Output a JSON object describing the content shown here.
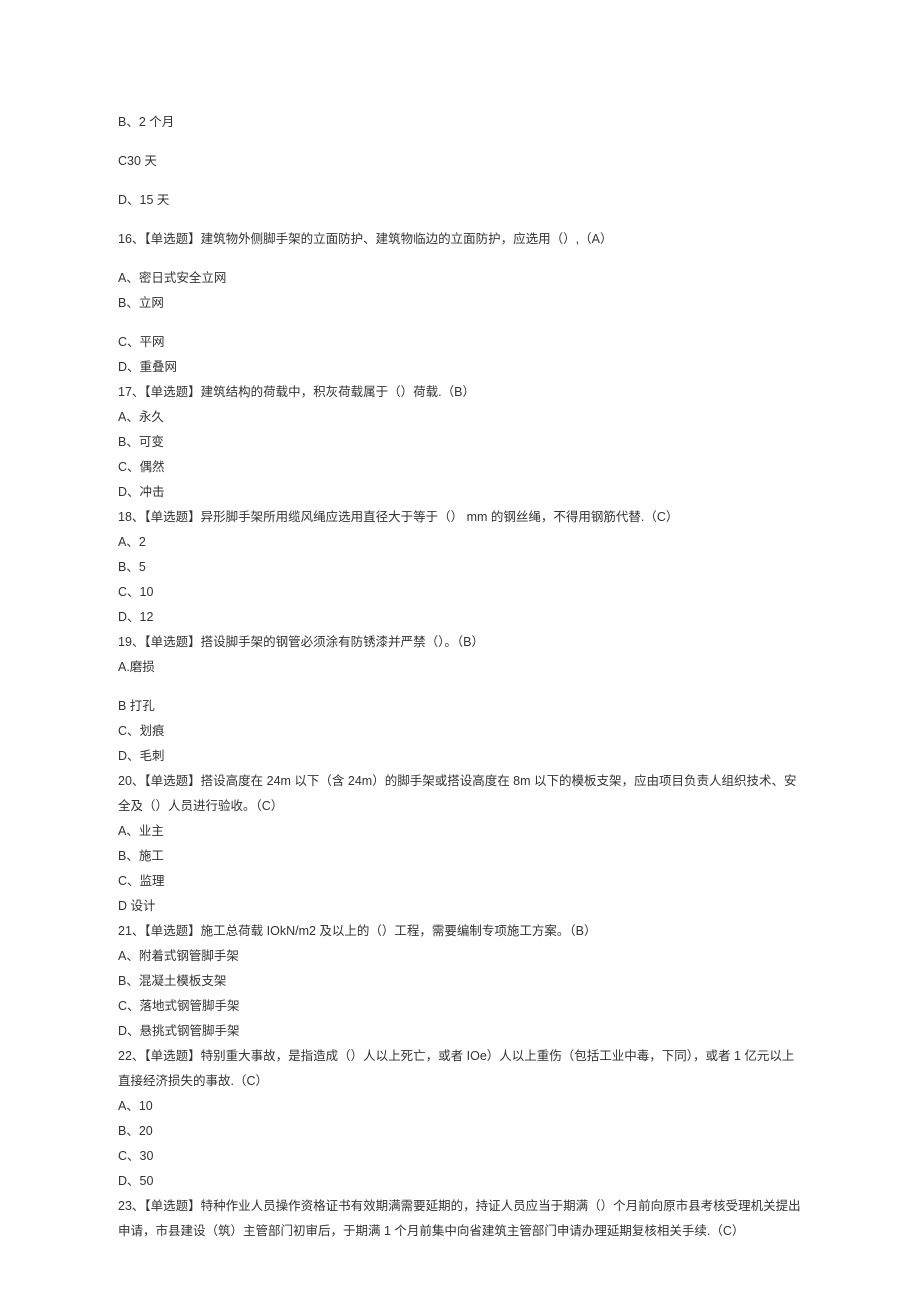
{
  "q15": {
    "b": "B、2 个月",
    "c": "C30 天",
    "d": "D、15 天"
  },
  "q16": {
    "stem": "16、【单选题】建筑物外侧脚手架的立面防护、建筑物临边的立面防护，应选用（）,（A）",
    "a": "A、密日式安全立网",
    "b": "B、立网",
    "c": "C、平网",
    "d": "D、重叠网"
  },
  "q17": {
    "stem": "17、【单选题】建筑结构的荷载中，积灰荷载属于（）荷载.（B）",
    "a": "A、永久",
    "b": "B、可变",
    "c": "C、偶然",
    "d": "D、冲击"
  },
  "q18": {
    "stem": "18、【单选题】异形脚手架所用缆风绳应选用直径大于等于（） mm 的钢丝绳，不得用钢筋代替.（C）",
    "a": "A、2",
    "b": "B、5",
    "c": "C、10",
    "d": "D、12"
  },
  "q19": {
    "stem": "19、【单选题】搭设脚手架的钢管必须涂有防锈漆并严禁（）。（B）",
    "a": "A.磨损",
    "b": "B 打孔",
    "c": "C、划痕",
    "d": "D、毛刺"
  },
  "q20": {
    "stem": "20、【单选题】搭设高度在 24m 以下（含 24m）的脚手架或搭设高度在 8m 以下的模板支架，应由项目负责人组织技术、安全及（）人员进行验收。（C）",
    "a": "A、业主",
    "b": "B、施工",
    "c": "C、监理",
    "d": "D 设计"
  },
  "q21": {
    "stem": "21、【单选题】施工总荷载 IOkN/m2 及以上的（）工程，需要编制专项施工方案。（B）",
    "a": "A、附着式钢管脚手架",
    "b": "B、混凝土模板支架",
    "c": "C、落地式钢管脚手架",
    "d": "D、悬挑式钢管脚手架"
  },
  "q22": {
    "stem": "22、【单选题】特别重大事故，是指造成（）人以上死亡，或者 IOe）人以上重伤（包括工业中毒，下同），或者 1 亿元以上直接经济损失的事故.（C）",
    "a": "A、10",
    "b": "B、20",
    "c": "C、30",
    "d": "D、50"
  },
  "q23": {
    "stem": "23、【单选题】特种作业人员操作资格证书有效期满需要延期的，持证人员应当于期满（）个月前向原市县考核受理机关提出申请，市县建设（筑）主管部门初审后，于期满 1 个月前集中向省建筑主管部门申请办理延期复核相关手续.（C）"
  }
}
